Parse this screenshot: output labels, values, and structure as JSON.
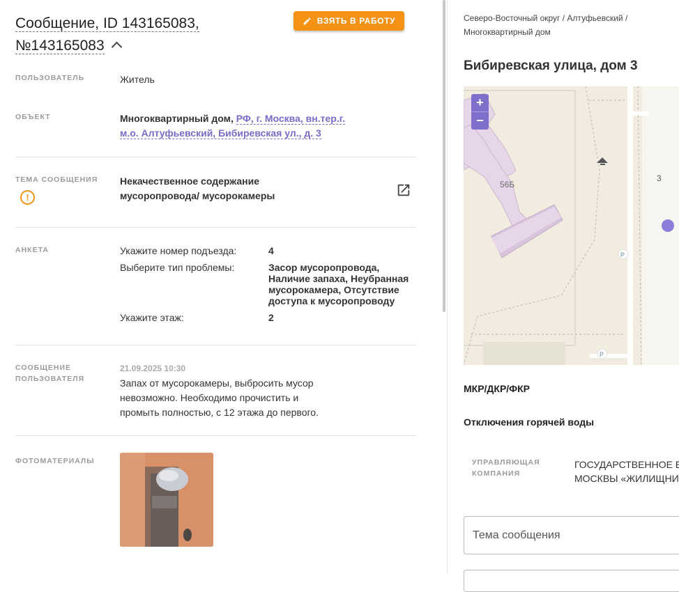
{
  "header": {
    "title_line1": "Сообщение, ID 143165083,",
    "title_line2": "№143165083",
    "take_button": "ВЗЯТЬ В РАБОТУ"
  },
  "fields": {
    "user_label": "ПОЛЬЗОВАТЕЛЬ",
    "user_value": "Житель",
    "object_label": "ОБЪЕКТ",
    "object_type": "Многоквартирный дом,",
    "object_link": "РФ, г. Москва, вн.тер.г. м.о. Алтуфьевский, Бибиревская ул., д. 3",
    "topic_label": "ТЕМА СООБЩЕНИЯ",
    "topic_value": "Некачественное содержание мусоропровода/ мусорокамеры",
    "form_label": "АНКЕТА",
    "form": [
      {
        "q": "Укажите номер подъезда:",
        "a": "4"
      },
      {
        "q": "Выберите тип проблемы:",
        "a": "Засор мусоропровода, Наличие запаха, Неубранная мусорокамера, Отсутствие доступа к мусоропроводу"
      },
      {
        "q": "Укажите этаж:",
        "a": "2"
      }
    ],
    "message_label_1": "СООБЩЕНИЕ",
    "message_label_2": "ПОЛЬЗОВАТЕЛЯ",
    "message_date": "21.09.2025 10:30",
    "message_text": "Запах от мусорокамеры, выбросить мусор невозможно. Необходимо прочистить и промыть полностью, с 12 этажа до первого.",
    "photos_label": "ФОТОМАТЕРИАЛЫ"
  },
  "right": {
    "breadcrumb": "Северо-Восточный округ / Алтуфьевский / Многоквартирный дом",
    "address": "Бибиревская улица, дом 3",
    "map": {
      "zoom_in": "+",
      "zoom_out": "−",
      "building_label": "56Б",
      "house_number": "3",
      "parking_label": "P"
    },
    "mkr_label": "МКР/ДКР/ФКР",
    "hot_water_label": "Отключения горячей воды",
    "uk_label_1": "УПРАВЛЯЮЩАЯ",
    "uk_label_2": "КОМПАНИЯ",
    "uk_value_1": "ГОСУДАРСТВЕННОЕ БК",
    "uk_value_2": "МОСКВЫ «ЖИЛИЩНИК",
    "topic_field_placeholder": "Тема сообщения"
  },
  "colors": {
    "accent_orange": "#f39215",
    "link_purple": "#7b6ac7",
    "zoom_purple": "#7d6fca"
  }
}
